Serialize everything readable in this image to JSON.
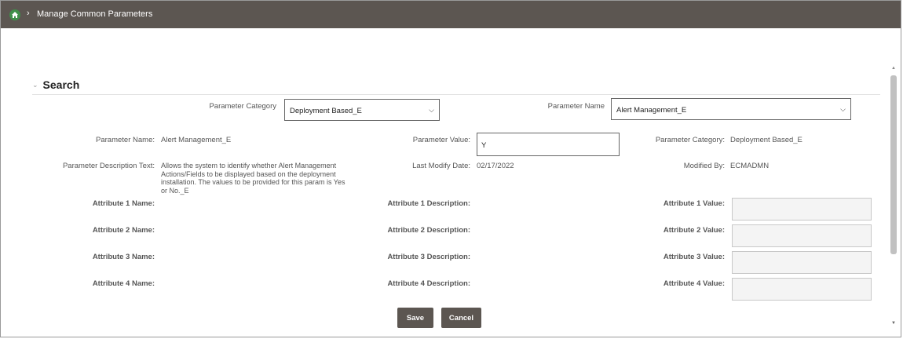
{
  "breadcrumb": {
    "separator": "›",
    "page": "Manage Common Parameters"
  },
  "search": {
    "title": "Search"
  },
  "filters": {
    "category_label": "Parameter Category",
    "category_value": "Deployment Based_E",
    "name_label": "Parameter Name",
    "name_value": "Alert Management_E"
  },
  "details": {
    "param_name_label": "Parameter Name:",
    "param_name_value": "Alert Management_E",
    "param_value_label": "Parameter Value:",
    "param_value_value": "Y",
    "param_category_label": "Parameter Category:",
    "param_category_value": "Deployment Based_E",
    "desc_label": "Parameter Description Text:",
    "desc_value": "Allows the system to identify whether Alert Management Actions/Fields to be displayed based on the deployment installation. The values to be provided for this param is Yes or No._E",
    "last_modify_label": "Last Modify Date:",
    "last_modify_value": "02/17/2022",
    "modified_by_label": "Modified By:",
    "modified_by_value": "ECMADMN"
  },
  "attributes": [
    {
      "name_label": "Attribute 1 Name:",
      "desc_label": "Attribute 1 Description:",
      "value_label": "Attribute 1 Value:"
    },
    {
      "name_label": "Attribute 2 Name:",
      "desc_label": "Attribute 2 Description:",
      "value_label": "Attribute 2 Value:"
    },
    {
      "name_label": "Attribute 3 Name:",
      "desc_label": "Attribute 3 Description:",
      "value_label": "Attribute 3 Value:"
    },
    {
      "name_label": "Attribute 4 Name:",
      "desc_label": "Attribute 4 Description:",
      "value_label": "Attribute 4 Value:"
    }
  ],
  "actions": {
    "save": "Save",
    "cancel": "Cancel"
  },
  "colors": {
    "topbar": "#5c5651",
    "home": "#3f8f49",
    "button": "#5c5651"
  }
}
